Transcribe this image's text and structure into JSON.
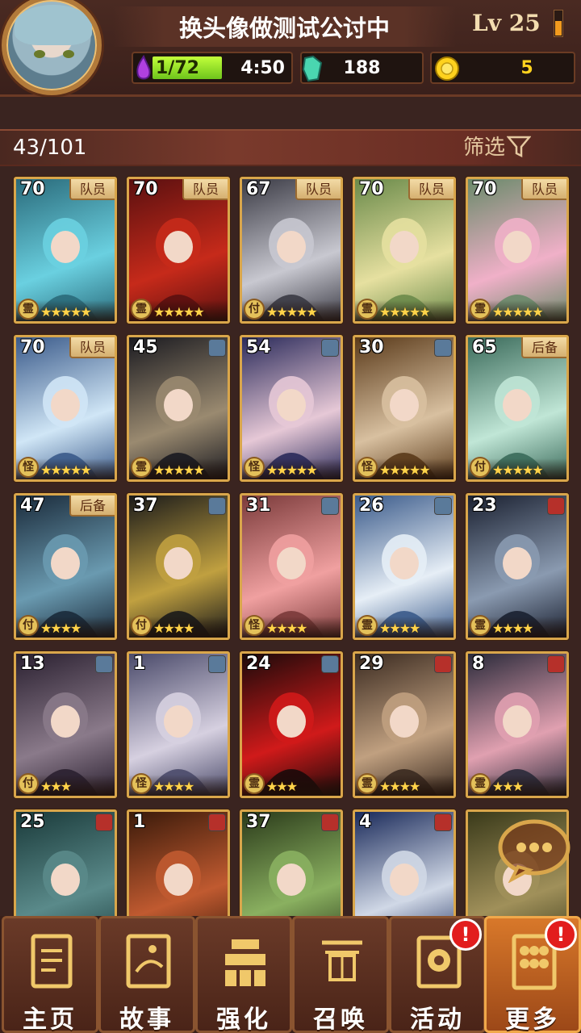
{
  "header": {
    "player_name": "换头像做测试公讨中",
    "level": "Lv 25",
    "stamina": "1/72",
    "stamina_timer": "4:50",
    "gems": "188",
    "coins": "5"
  },
  "roster": {
    "count": "43/101",
    "filter_label": "筛选"
  },
  "cards": [
    {
      "level": "70",
      "tag": "队员",
      "weapon": "",
      "element": "霊",
      "stars": "★★★★★",
      "art": [
        "#2a6a7a",
        "#6ad0e0"
      ]
    },
    {
      "level": "70",
      "tag": "队员",
      "weapon": "",
      "element": "霊",
      "stars": "★★★★★",
      "art": [
        "#5a1010",
        "#c62a1a"
      ]
    },
    {
      "level": "67",
      "tag": "队员",
      "weapon": "",
      "element": "付",
      "stars": "★★★★★",
      "art": [
        "#3a3a44",
        "#c8c8d0"
      ]
    },
    {
      "level": "70",
      "tag": "队员",
      "weapon": "",
      "element": "霊",
      "stars": "★★★★★",
      "art": [
        "#6a8a4a",
        "#e6e0a0"
      ]
    },
    {
      "level": "70",
      "tag": "队员",
      "weapon": "",
      "element": "霊",
      "stars": "★★★★★",
      "art": [
        "#6a8a6a",
        "#f0b0c8"
      ]
    },
    {
      "level": "70",
      "tag": "队员",
      "weapon": "",
      "element": "怪",
      "stars": "★★★★★",
      "art": [
        "#3a5a8a",
        "#d0e6f6"
      ]
    },
    {
      "level": "45",
      "tag": "",
      "weapon": "blue",
      "element": "霊",
      "stars": "★★★★★",
      "art": [
        "#1a1a20",
        "#9a8a70"
      ]
    },
    {
      "level": "54",
      "tag": "",
      "weapon": "blue",
      "element": "怪",
      "stars": "★★★★★",
      "art": [
        "#2a2a5a",
        "#e6c8d6"
      ]
    },
    {
      "level": "30",
      "tag": "",
      "weapon": "blue",
      "element": "怪",
      "stars": "★★★★★",
      "art": [
        "#5a3a1a",
        "#d8c0a0"
      ]
    },
    {
      "level": "65",
      "tag": "后备",
      "weapon": "",
      "element": "付",
      "stars": "★★★★★",
      "art": [
        "#3a6a5a",
        "#c0e6d6"
      ]
    },
    {
      "level": "47",
      "tag": "后备",
      "weapon": "",
      "element": "付",
      "stars": "★★★★",
      "art": [
        "#1a2a3a",
        "#6a9ab0"
      ]
    },
    {
      "level": "37",
      "tag": "",
      "weapon": "blue",
      "element": "付",
      "stars": "★★★★",
      "art": [
        "#1a1a1a",
        "#c0a040"
      ]
    },
    {
      "level": "31",
      "tag": "",
      "weapon": "blue",
      "element": "怪",
      "stars": "★★★★",
      "art": [
        "#7a3a3a",
        "#f0a0a0"
      ]
    },
    {
      "level": "26",
      "tag": "",
      "weapon": "blue",
      "element": "霊",
      "stars": "★★★★",
      "art": [
        "#3a5a8a",
        "#e6eef6"
      ]
    },
    {
      "level": "23",
      "tag": "",
      "weapon": "red",
      "element": "霊",
      "stars": "★★★★",
      "art": [
        "#1a2030",
        "#8a9ab0"
      ]
    },
    {
      "level": "13",
      "tag": "",
      "weapon": "blue",
      "element": "付",
      "stars": "★★★",
      "art": [
        "#2a2030",
        "#8a7a8a"
      ]
    },
    {
      "level": "1",
      "tag": "",
      "weapon": "blue",
      "element": "怪",
      "stars": "★★★★",
      "art": [
        "#4a4a6a",
        "#d6d0e0"
      ]
    },
    {
      "level": "24",
      "tag": "",
      "weapon": "blue",
      "element": "霊",
      "stars": "★★★",
      "art": [
        "#1a0a0a",
        "#d01a1a"
      ]
    },
    {
      "level": "29",
      "tag": "",
      "weapon": "red",
      "element": "霊",
      "stars": "★★★★",
      "art": [
        "#3a2a20",
        "#c0a080"
      ]
    },
    {
      "level": "8",
      "tag": "",
      "weapon": "red",
      "element": "霊",
      "stars": "★★★",
      "art": [
        "#2a2a3a",
        "#e0a0b0"
      ]
    },
    {
      "level": "25",
      "tag": "",
      "weapon": "red",
      "element": "",
      "stars": "",
      "art": [
        "#1a3a3a",
        "#5a8a8a"
      ]
    },
    {
      "level": "1",
      "tag": "",
      "weapon": "red",
      "element": "",
      "stars": "",
      "art": [
        "#3a1a0a",
        "#c05a30"
      ]
    },
    {
      "level": "37",
      "tag": "",
      "weapon": "red",
      "element": "",
      "stars": "",
      "art": [
        "#2a3a1a",
        "#8ab060"
      ]
    },
    {
      "level": "4",
      "tag": "",
      "weapon": "red",
      "element": "",
      "stars": "",
      "art": [
        "#1a2a5a",
        "#d0d8e6"
      ]
    },
    {
      "level": "",
      "tag": "",
      "weapon": "",
      "element": "",
      "stars": "",
      "art": [
        "#3a3a1a",
        "#a0905a"
      ]
    }
  ],
  "nav": [
    {
      "label": "主页",
      "icon": "clipboard-icon",
      "alert": ""
    },
    {
      "label": "故事",
      "icon": "story-book-icon",
      "alert": ""
    },
    {
      "label": "强化",
      "icon": "bars-icon",
      "alert": ""
    },
    {
      "label": "召唤",
      "icon": "gate-icon",
      "alert": ""
    },
    {
      "label": "活动",
      "icon": "event-icon",
      "alert": "!"
    },
    {
      "label": "更多",
      "icon": "menu-grid-icon",
      "alert": "!"
    }
  ],
  "colors": {
    "accent": "#f0a84a",
    "gold_border": "#d9a64b",
    "alert": "#e21d1d"
  }
}
